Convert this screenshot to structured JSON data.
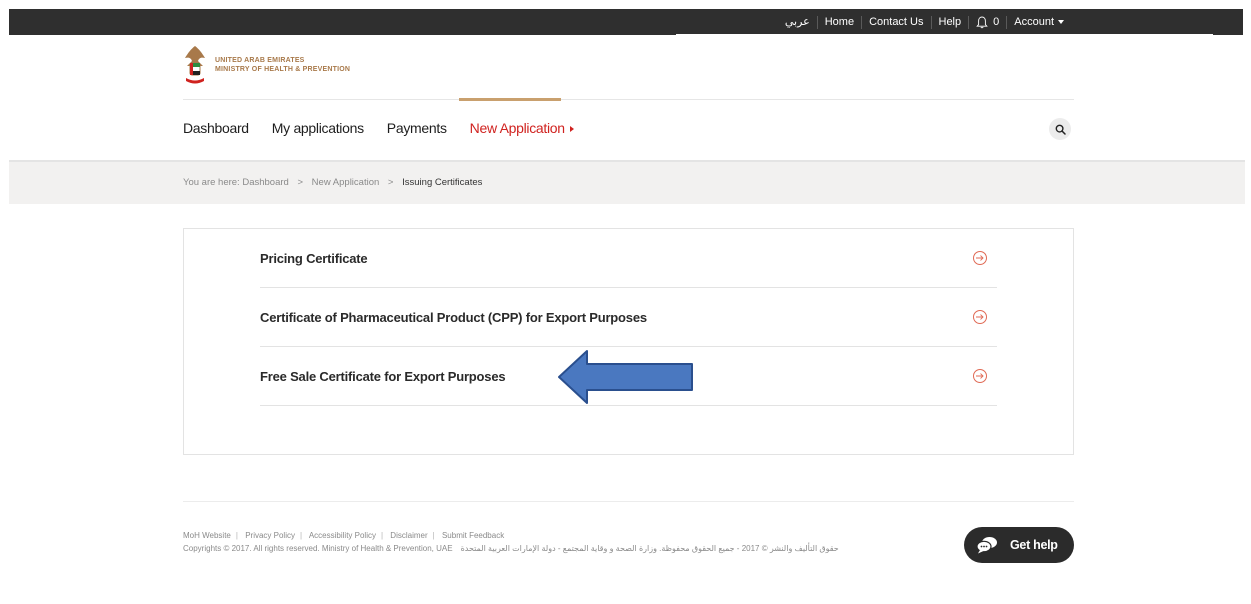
{
  "topbar": {
    "arabic_label": "عربي",
    "home": "Home",
    "contact": "Contact Us",
    "help": "Help",
    "notification_count": "0",
    "account": "Account"
  },
  "logo": {
    "line1": "UNITED ARAB EMIRATES",
    "line2": "MINISTRY OF HEALTH & PREVENTION"
  },
  "nav": {
    "dashboard": "Dashboard",
    "my_applications": "My applications",
    "payments": "Payments",
    "new_application": "New Application"
  },
  "breadcrumb": {
    "prefix": "You are here:",
    "items": [
      "Dashboard",
      "New Application",
      "Issuing Certificates"
    ],
    "separator": ">"
  },
  "certificates": [
    "Pricing Certificate",
    "Certificate of Pharmaceutical Product (CPP) for Export Purposes",
    "Free Sale Certificate for Export Purposes"
  ],
  "footer": {
    "links": [
      "MoH Website",
      "Privacy Policy",
      "Accessibility Policy",
      "Disclaimer",
      "Submit Feedback"
    ],
    "copyright": "Copyrights © 2017. All rights reserved. Ministry of Health & Prevention, UAE",
    "copyright_ar": "حقوق التأليف والنشر © 2017 - جميع الحقوق محفوظة. وزارة الصحة و وقاية المجتمع - دولة الإمارات العربية المتحدة"
  },
  "gethelp": {
    "label": "Get help"
  },
  "colors": {
    "accent": "#d0221f",
    "gold": "#c9a06e",
    "topbar": "#2f2f2f",
    "arrow": "#3f6fb5"
  },
  "icons": [
    "bell-icon",
    "caret-down-icon",
    "emblem-icon",
    "search-icon",
    "arrow-right-circle-icon",
    "chat-bubble-icon"
  ]
}
